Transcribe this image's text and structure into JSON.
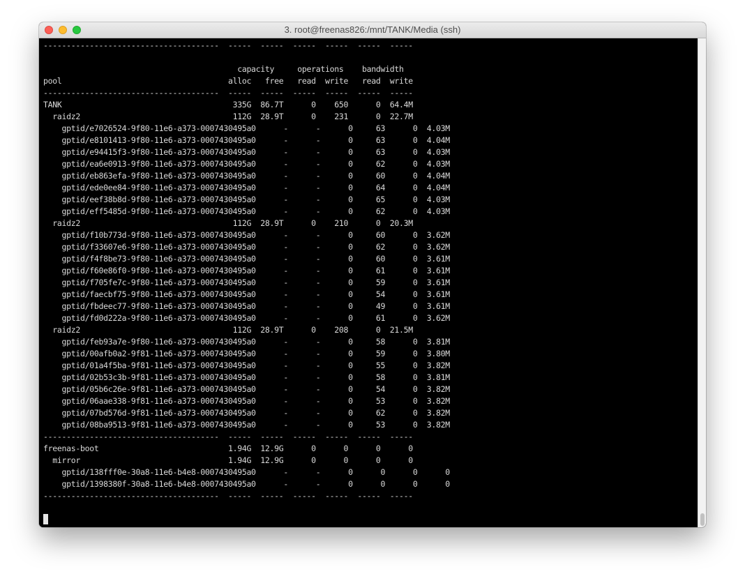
{
  "window": {
    "title": "3. root@freenas826:/mnt/TANK/Media (ssh)"
  },
  "terminal": {
    "lines": [
      "--------------------------------------  -----  -----  -----  -----  -----  -----",
      "",
      "                                          capacity     operations    bandwidth",
      "pool                                    alloc   free   read  write   read  write",
      "--------------------------------------  -----  -----  -----  -----  -----  -----",
      "TANK                                     335G  86.7T      0    650      0  64.4M",
      "  raidz2                                 112G  28.9T      0    231      0  22.7M",
      "    gptid/e7026524-9f80-11e6-a373-0007430495a0      -      -      0     63      0  4.03M",
      "    gptid/e8101413-9f80-11e6-a373-0007430495a0      -      -      0     63      0  4.04M",
      "    gptid/e94415f3-9f80-11e6-a373-0007430495a0      -      -      0     63      0  4.03M",
      "    gptid/ea6e0913-9f80-11e6-a373-0007430495a0      -      -      0     62      0  4.03M",
      "    gptid/eb863efa-9f80-11e6-a373-0007430495a0      -      -      0     60      0  4.04M",
      "    gptid/ede0ee84-9f80-11e6-a373-0007430495a0      -      -      0     64      0  4.04M",
      "    gptid/eef38b8d-9f80-11e6-a373-0007430495a0      -      -      0     65      0  4.03M",
      "    gptid/eff5485d-9f80-11e6-a373-0007430495a0      -      -      0     62      0  4.03M",
      "  raidz2                                 112G  28.9T      0    210      0  20.3M",
      "    gptid/f10b773d-9f80-11e6-a373-0007430495a0      -      -      0     60      0  3.62M",
      "    gptid/f33607e6-9f80-11e6-a373-0007430495a0      -      -      0     62      0  3.62M",
      "    gptid/f4f8be73-9f80-11e6-a373-0007430495a0      -      -      0     60      0  3.61M",
      "    gptid/f60e86f0-9f80-11e6-a373-0007430495a0      -      -      0     61      0  3.61M",
      "    gptid/f705fe7c-9f80-11e6-a373-0007430495a0      -      -      0     59      0  3.61M",
      "    gptid/faecbf75-9f80-11e6-a373-0007430495a0      -      -      0     54      0  3.61M",
      "    gptid/fbdeec77-9f80-11e6-a373-0007430495a0      -      -      0     49      0  3.61M",
      "    gptid/fd0d222a-9f80-11e6-a373-0007430495a0      -      -      0     61      0  3.62M",
      "  raidz2                                 112G  28.9T      0    208      0  21.5M",
      "    gptid/feb93a7e-9f80-11e6-a373-0007430495a0      -      -      0     58      0  3.81M",
      "    gptid/00afb0a2-9f81-11e6-a373-0007430495a0      -      -      0     59      0  3.80M",
      "    gptid/01a4f5ba-9f81-11e6-a373-0007430495a0      -      -      0     55      0  3.82M",
      "    gptid/02b53c3b-9f81-11e6-a373-0007430495a0      -      -      0     58      0  3.81M",
      "    gptid/05b6c26e-9f81-11e6-a373-0007430495a0      -      -      0     54      0  3.82M",
      "    gptid/06aae338-9f81-11e6-a373-0007430495a0      -      -      0     53      0  3.82M",
      "    gptid/07bd576d-9f81-11e6-a373-0007430495a0      -      -      0     62      0  3.82M",
      "    gptid/08ba9513-9f81-11e6-a373-0007430495a0      -      -      0     53      0  3.82M",
      "--------------------------------------  -----  -----  -----  -----  -----  -----",
      "freenas-boot                            1.94G  12.9G      0      0      0      0",
      "  mirror                                1.94G  12.9G      0      0      0      0",
      "    gptid/138fff0e-30a8-11e6-b4e8-0007430495a0      -      -      0      0      0      0",
      "    gptid/1398380f-30a8-11e6-b4e8-0007430495a0      -      -      0      0      0      0",
      "--------------------------------------  -----  -----  -----  -----  -----  -----",
      "",
      ""
    ]
  }
}
